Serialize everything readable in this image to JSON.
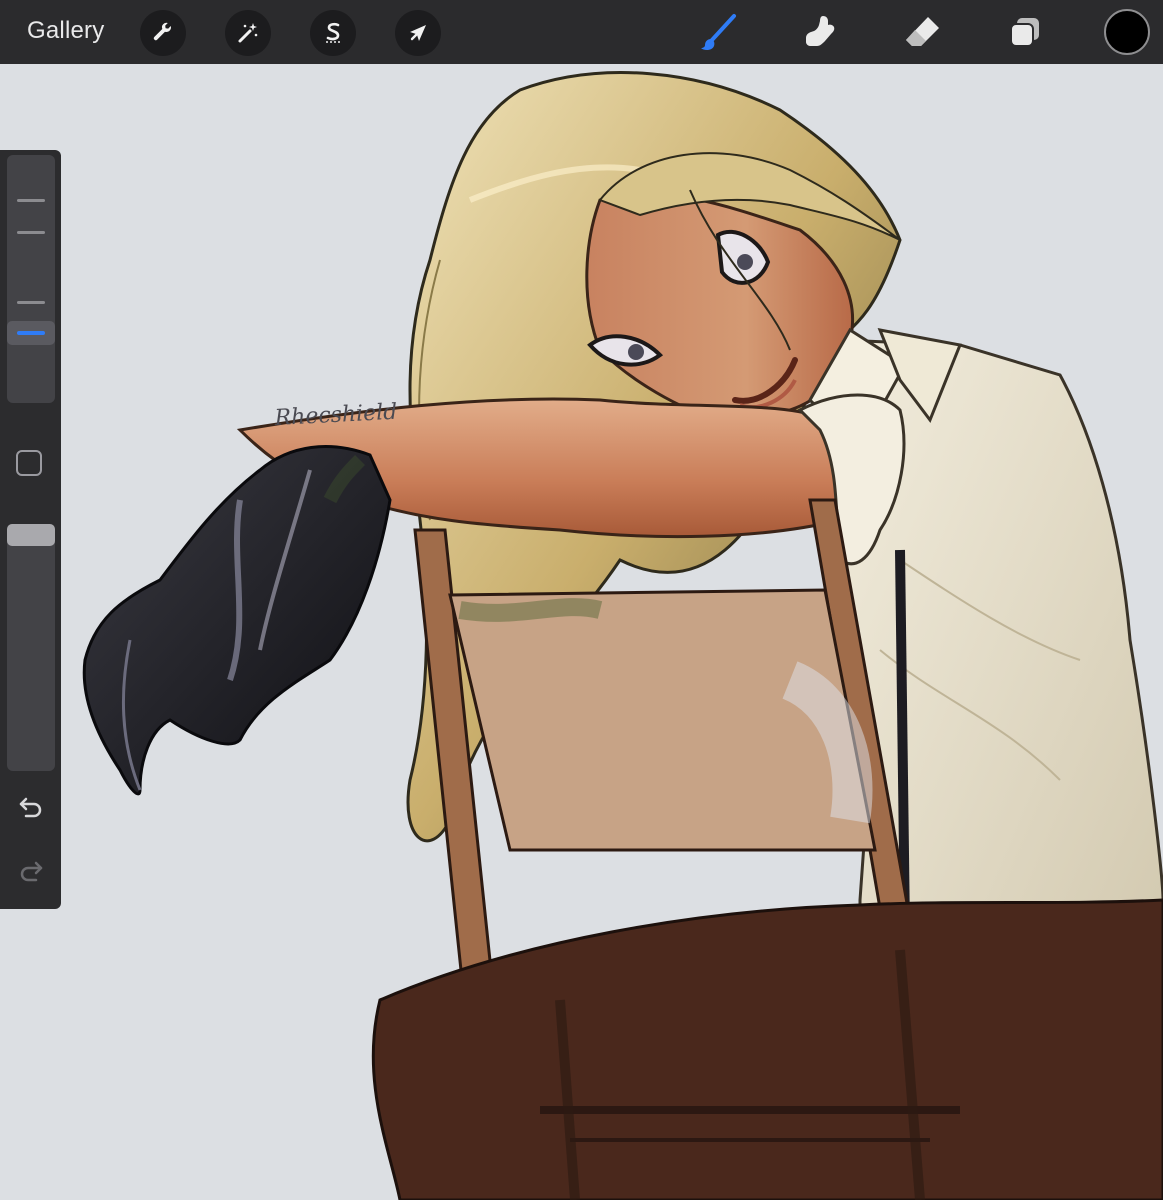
{
  "toolbar": {
    "gallery_label": "Gallery",
    "left_tools": [
      {
        "name": "actions",
        "icon": "wrench-icon"
      },
      {
        "name": "adjustments",
        "icon": "magic-wand-icon"
      },
      {
        "name": "selection",
        "icon": "selection-s-icon"
      },
      {
        "name": "transform",
        "icon": "arrow-cursor-icon"
      }
    ],
    "right_tools": [
      {
        "name": "brush",
        "icon": "brush-icon",
        "active": true
      },
      {
        "name": "smudge",
        "icon": "smudge-finger-icon",
        "active": false
      },
      {
        "name": "eraser",
        "icon": "eraser-icon",
        "active": false
      },
      {
        "name": "layers",
        "icon": "layers-icon",
        "active": false
      }
    ],
    "current_color": "#000000",
    "active_color": "#2f7cf6"
  },
  "sidebar": {
    "brush_size_icon": "size-slider",
    "modify_icon": "square-modify-icon",
    "opacity_icon": "opacity-slider",
    "undo_icon": "undo-icon",
    "redo_icon": "redo-icon"
  },
  "canvas": {
    "background": "#dcdfe3",
    "signature": "Rhecshield"
  }
}
